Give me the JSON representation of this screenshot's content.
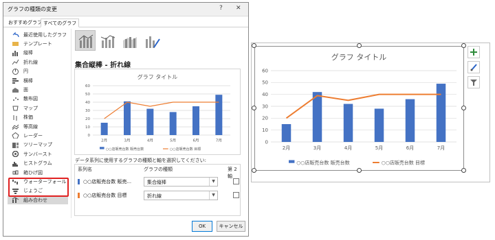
{
  "dialog": {
    "title": "グラフの種類の変更",
    "help_label": "?",
    "close_label": "✕",
    "tabs": [
      {
        "label": "おすすめグラフ"
      },
      {
        "label": "すべてのグラフ"
      }
    ],
    "chart_types": [
      {
        "label": "最近使用したグラフ",
        "icon": "undo-icon"
      },
      {
        "label": "テンプレート",
        "icon": "folder-icon"
      },
      {
        "label": "縦棒",
        "icon": "column-chart-icon"
      },
      {
        "label": "折れ線",
        "icon": "line-chart-icon"
      },
      {
        "label": "円",
        "icon": "pie-chart-icon"
      },
      {
        "label": "横棒",
        "icon": "bar-chart-icon"
      },
      {
        "label": "面",
        "icon": "area-chart-icon"
      },
      {
        "label": "散布図",
        "icon": "scatter-chart-icon"
      },
      {
        "label": "マップ",
        "icon": "map-chart-icon"
      },
      {
        "label": "株価",
        "icon": "stock-chart-icon"
      },
      {
        "label": "等高線",
        "icon": "surface-chart-icon"
      },
      {
        "label": "レーダー",
        "icon": "radar-chart-icon"
      },
      {
        "label": "ツリーマップ",
        "icon": "treemap-icon"
      },
      {
        "label": "サンバースト",
        "icon": "sunburst-icon"
      },
      {
        "label": "ヒストグラム",
        "icon": "histogram-icon"
      },
      {
        "label": "箱ひげ図",
        "icon": "box-whisker-icon"
      },
      {
        "label": "ウォーターフォール",
        "icon": "waterfall-icon"
      },
      {
        "label": "じょうご",
        "icon": "funnel-icon"
      },
      {
        "label": "組み合わせ",
        "icon": "combo-chart-icon"
      }
    ],
    "selected_type": "組み合わせ",
    "combo_title": "集合縦棒 - 折れ線",
    "series_instruction": "データ系列に使用するグラフの種類と軸を選択してください:",
    "series_headers": {
      "name": "系列名",
      "type": "グラフの種類",
      "axis": "第 2 軸"
    },
    "series": [
      {
        "name": "○○店販売台数 販売...",
        "type": "集合縦棒",
        "color": "#4472c4",
        "secondary_axis": false
      },
      {
        "name": "○○店販売台数 目標",
        "type": "折れ線",
        "color": "#ed7d31",
        "secondary_axis": false
      }
    ],
    "ok_label": "OK",
    "cancel_label": "キャンセル"
  },
  "colors": {
    "bar": "#4472c4",
    "line": "#ed7d31",
    "highlight": "#e02020"
  },
  "side_buttons": [
    {
      "icon": "plus-icon"
    },
    {
      "icon": "brush-icon"
    },
    {
      "icon": "filter-icon"
    }
  ],
  "chart_data": [
    {
      "type": "bar",
      "title": "グラフ タイトル",
      "categories": [
        "2月",
        "3月",
        "4月",
        "5月",
        "6月",
        "7月"
      ],
      "series": [
        {
          "name": "○○店販売台数 販売台数",
          "type": "bar",
          "values": [
            15,
            41,
            32,
            28,
            35,
            49
          ]
        },
        {
          "name": "○○店販売台数 目標",
          "type": "line",
          "values": [
            20,
            40,
            35,
            40,
            40,
            40
          ]
        }
      ],
      "ylim": [
        0,
        60
      ],
      "yticks": [
        0,
        10,
        20,
        30,
        40,
        50,
        60
      ],
      "grid": true,
      "legend": "bottom"
    },
    {
      "type": "bar",
      "title": "グラフ タイトル",
      "categories": [
        "2月",
        "3月",
        "4月",
        "5月",
        "6月",
        "7月"
      ],
      "series": [
        {
          "name": "○○店販売台数 販売台数",
          "type": "bar",
          "values": [
            15,
            42,
            32,
            28,
            36,
            49
          ]
        },
        {
          "name": "○○店販売台数 目標",
          "type": "line",
          "values": [
            20,
            39,
            35,
            40,
            40,
            40
          ]
        }
      ],
      "ylim": [
        0,
        60
      ],
      "yticks": [
        0,
        10,
        20,
        30,
        40,
        50,
        60
      ],
      "grid": true,
      "legend": "bottom"
    }
  ]
}
